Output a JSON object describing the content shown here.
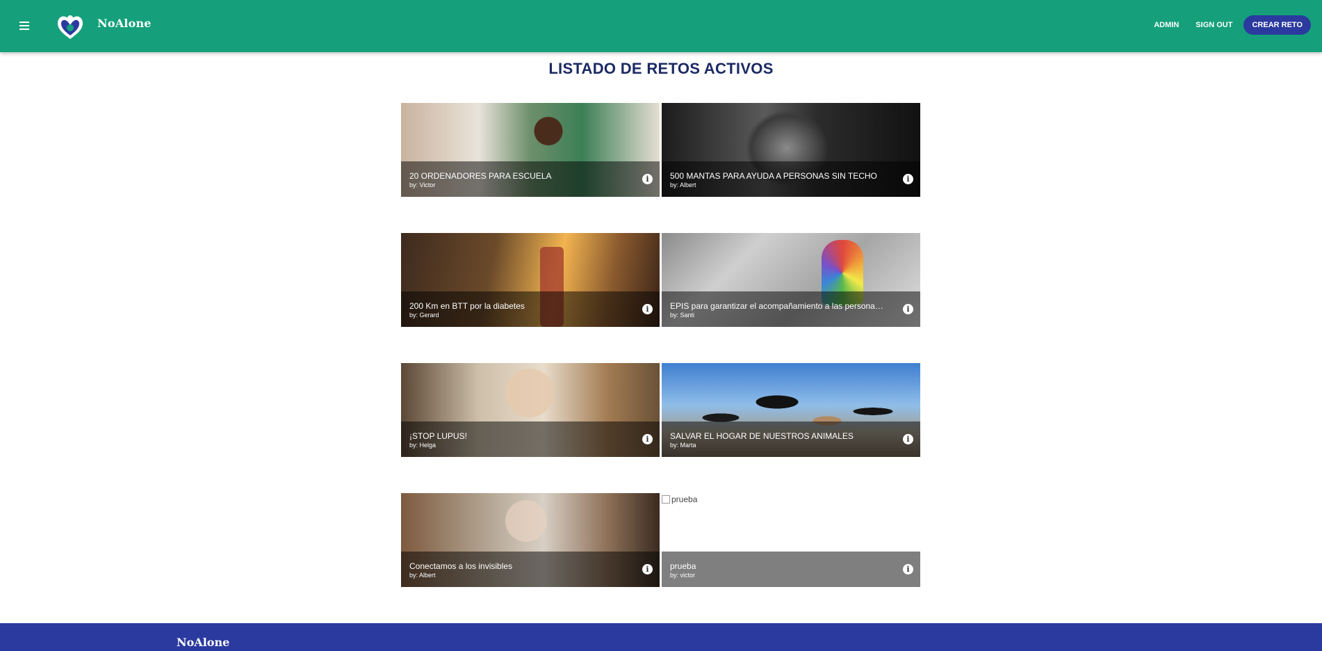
{
  "header": {
    "brand": "NoAlone",
    "nav": {
      "admin": "ADMIN",
      "sign_out": "SIGN OUT",
      "create": "CREAR RETO"
    }
  },
  "colors": {
    "header": "#15a07b",
    "accent": "#2b3a9f",
    "title": "#1b2a63"
  },
  "main": {
    "title": "LISTADO DE RETOS ACTIVOS",
    "tiles": [
      {
        "title": "20 ORDENADORES PARA ESCUELA",
        "by": "by: Victor"
      },
      {
        "title": "500 MANTAS PARA AYUDA A PERSONAS SIN TECHO",
        "by": "by: Albert"
      },
      {
        "title": "200 Km en BTT por la diabetes",
        "by": "by: Gerard"
      },
      {
        "title": "EPIS para garantizar el acompañamiento a las personas c...",
        "by": "by: Santi"
      },
      {
        "title": "¡STOP LUPUS!",
        "by": "by: Helga"
      },
      {
        "title": "SALVAR EL HOGAR DE NUESTROS ANIMALES",
        "by": "by: Marta"
      },
      {
        "title": "Conectamos a los invisibles",
        "by": "by: Albert"
      },
      {
        "title": "prueba",
        "by": "by: victor",
        "image_alt": "prueba"
      }
    ]
  },
  "footer": {
    "brand": "NoAlone"
  }
}
